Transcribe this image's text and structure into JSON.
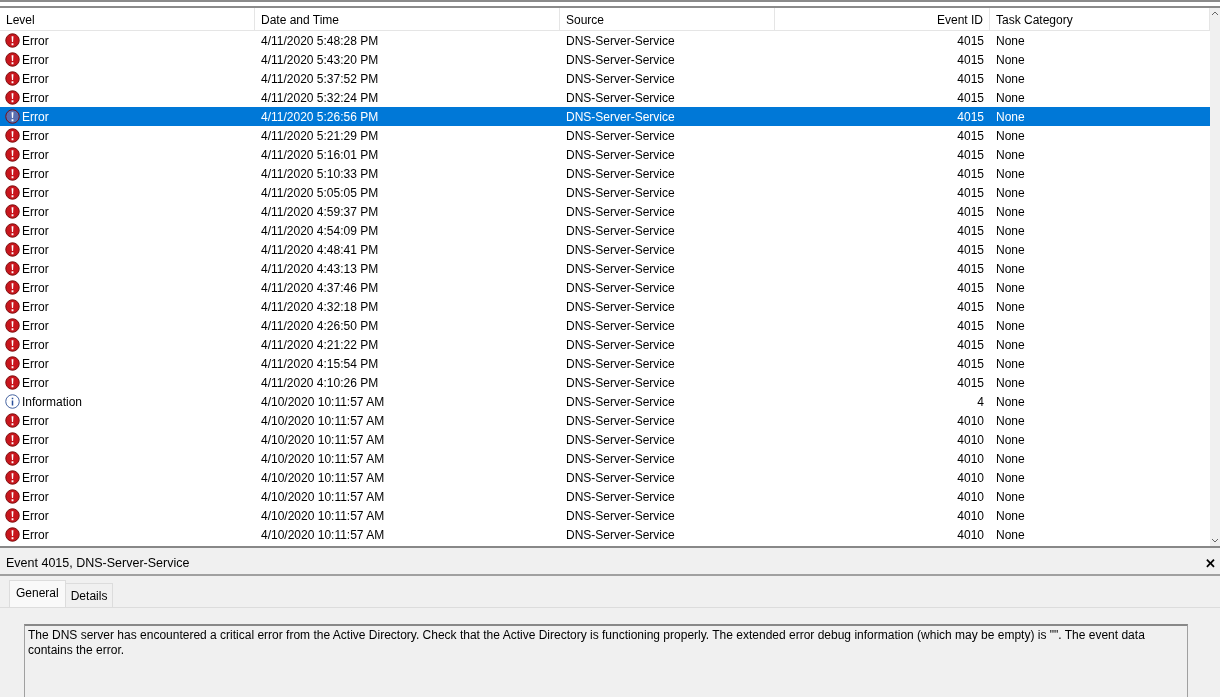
{
  "columns": [
    "Level",
    "Date and Time",
    "Source",
    "Event ID",
    "Task Category"
  ],
  "rows": [
    {
      "kind": "error",
      "level": "Error",
      "date": "4/11/2020 5:48:28 PM",
      "source": "DNS-Server-Service",
      "event_id": "4015",
      "task": "None",
      "selected": false
    },
    {
      "kind": "error",
      "level": "Error",
      "date": "4/11/2020 5:43:20 PM",
      "source": "DNS-Server-Service",
      "event_id": "4015",
      "task": "None",
      "selected": false
    },
    {
      "kind": "error",
      "level": "Error",
      "date": "4/11/2020 5:37:52 PM",
      "source": "DNS-Server-Service",
      "event_id": "4015",
      "task": "None",
      "selected": false
    },
    {
      "kind": "error",
      "level": "Error",
      "date": "4/11/2020 5:32:24 PM",
      "source": "DNS-Server-Service",
      "event_id": "4015",
      "task": "None",
      "selected": false
    },
    {
      "kind": "error",
      "level": "Error",
      "date": "4/11/2020 5:26:56 PM",
      "source": "DNS-Server-Service",
      "event_id": "4015",
      "task": "None",
      "selected": true
    },
    {
      "kind": "error",
      "level": "Error",
      "date": "4/11/2020 5:21:29 PM",
      "source": "DNS-Server-Service",
      "event_id": "4015",
      "task": "None",
      "selected": false
    },
    {
      "kind": "error",
      "level": "Error",
      "date": "4/11/2020 5:16:01 PM",
      "source": "DNS-Server-Service",
      "event_id": "4015",
      "task": "None",
      "selected": false
    },
    {
      "kind": "error",
      "level": "Error",
      "date": "4/11/2020 5:10:33 PM",
      "source": "DNS-Server-Service",
      "event_id": "4015",
      "task": "None",
      "selected": false
    },
    {
      "kind": "error",
      "level": "Error",
      "date": "4/11/2020 5:05:05 PM",
      "source": "DNS-Server-Service",
      "event_id": "4015",
      "task": "None",
      "selected": false
    },
    {
      "kind": "error",
      "level": "Error",
      "date": "4/11/2020 4:59:37 PM",
      "source": "DNS-Server-Service",
      "event_id": "4015",
      "task": "None",
      "selected": false
    },
    {
      "kind": "error",
      "level": "Error",
      "date": "4/11/2020 4:54:09 PM",
      "source": "DNS-Server-Service",
      "event_id": "4015",
      "task": "None",
      "selected": false
    },
    {
      "kind": "error",
      "level": "Error",
      "date": "4/11/2020 4:48:41 PM",
      "source": "DNS-Server-Service",
      "event_id": "4015",
      "task": "None",
      "selected": false
    },
    {
      "kind": "error",
      "level": "Error",
      "date": "4/11/2020 4:43:13 PM",
      "source": "DNS-Server-Service",
      "event_id": "4015",
      "task": "None",
      "selected": false
    },
    {
      "kind": "error",
      "level": "Error",
      "date": "4/11/2020 4:37:46 PM",
      "source": "DNS-Server-Service",
      "event_id": "4015",
      "task": "None",
      "selected": false
    },
    {
      "kind": "error",
      "level": "Error",
      "date": "4/11/2020 4:32:18 PM",
      "source": "DNS-Server-Service",
      "event_id": "4015",
      "task": "None",
      "selected": false
    },
    {
      "kind": "error",
      "level": "Error",
      "date": "4/11/2020 4:26:50 PM",
      "source": "DNS-Server-Service",
      "event_id": "4015",
      "task": "None",
      "selected": false
    },
    {
      "kind": "error",
      "level": "Error",
      "date": "4/11/2020 4:21:22 PM",
      "source": "DNS-Server-Service",
      "event_id": "4015",
      "task": "None",
      "selected": false
    },
    {
      "kind": "error",
      "level": "Error",
      "date": "4/11/2020 4:15:54 PM",
      "source": "DNS-Server-Service",
      "event_id": "4015",
      "task": "None",
      "selected": false
    },
    {
      "kind": "error",
      "level": "Error",
      "date": "4/11/2020 4:10:26 PM",
      "source": "DNS-Server-Service",
      "event_id": "4015",
      "task": "None",
      "selected": false
    },
    {
      "kind": "information",
      "level": "Information",
      "date": "4/10/2020 10:11:57 AM",
      "source": "DNS-Server-Service",
      "event_id": "4",
      "task": "None",
      "selected": false
    },
    {
      "kind": "error",
      "level": "Error",
      "date": "4/10/2020 10:11:57 AM",
      "source": "DNS-Server-Service",
      "event_id": "4010",
      "task": "None",
      "selected": false
    },
    {
      "kind": "error",
      "level": "Error",
      "date": "4/10/2020 10:11:57 AM",
      "source": "DNS-Server-Service",
      "event_id": "4010",
      "task": "None",
      "selected": false
    },
    {
      "kind": "error",
      "level": "Error",
      "date": "4/10/2020 10:11:57 AM",
      "source": "DNS-Server-Service",
      "event_id": "4010",
      "task": "None",
      "selected": false
    },
    {
      "kind": "error",
      "level": "Error",
      "date": "4/10/2020 10:11:57 AM",
      "source": "DNS-Server-Service",
      "event_id": "4010",
      "task": "None",
      "selected": false
    },
    {
      "kind": "error",
      "level": "Error",
      "date": "4/10/2020 10:11:57 AM",
      "source": "DNS-Server-Service",
      "event_id": "4010",
      "task": "None",
      "selected": false
    },
    {
      "kind": "error",
      "level": "Error",
      "date": "4/10/2020 10:11:57 AM",
      "source": "DNS-Server-Service",
      "event_id": "4010",
      "task": "None",
      "selected": false
    },
    {
      "kind": "error",
      "level": "Error",
      "date": "4/10/2020 10:11:57 AM",
      "source": "DNS-Server-Service",
      "event_id": "4010",
      "task": "None",
      "selected": false
    }
  ],
  "detail": {
    "title": "Event 4015, DNS-Server-Service",
    "close": "✕",
    "tabs": [
      {
        "label": "General",
        "selected": true
      },
      {
        "label": "Details",
        "selected": false
      }
    ],
    "message": "The DNS server has encountered a critical error from the Active Directory. Check that the Active Directory is functioning properly. The extended error debug information (which may be empty) is \"\". The event data contains the error."
  }
}
